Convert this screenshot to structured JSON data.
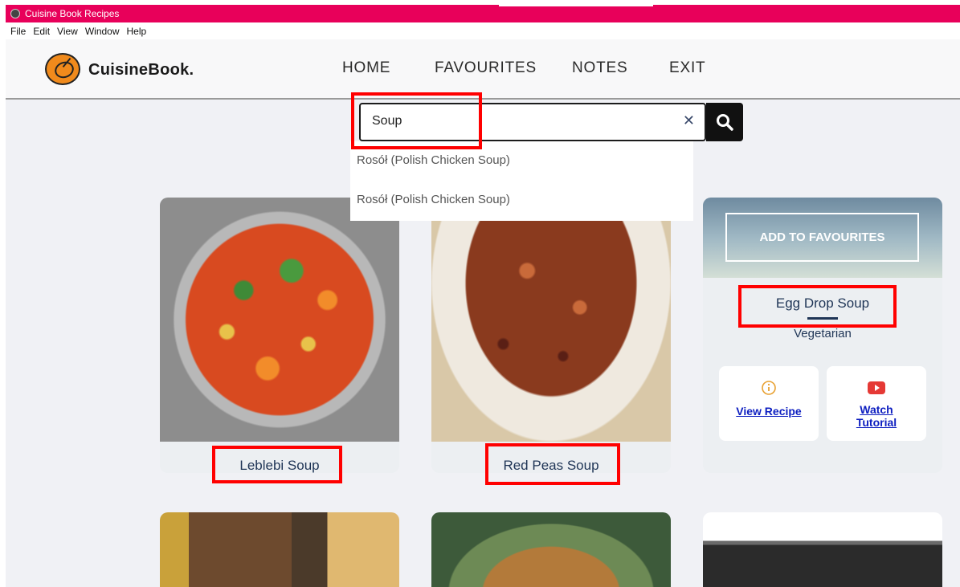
{
  "window": {
    "title": "Cuisine Book Recipes"
  },
  "menu": [
    "File",
    "Edit",
    "View",
    "Window",
    "Help"
  ],
  "brand": {
    "name": "CuisineBook.",
    "accent": "#e8005a"
  },
  "nav": {
    "items": [
      "HOME",
      "FAVOURITES",
      "NOTES",
      "EXIT"
    ]
  },
  "search": {
    "value": "Soup",
    "clear_icon": "close-icon",
    "button_icon": "search-icon"
  },
  "suggestions": [
    "Rosół (Polish Chicken Soup)",
    "Rosół (Polish Chicken Soup)"
  ],
  "cards": [
    {
      "title": "Leblebi Soup"
    },
    {
      "title": "Red Peas Soup"
    },
    {
      "title": "Egg Drop Soup",
      "category": "Vegetarian",
      "favourite_label": "ADD TO FAVOURITES",
      "actions": {
        "view": "View Recipe",
        "watch": "Watch Tutorial"
      }
    }
  ]
}
